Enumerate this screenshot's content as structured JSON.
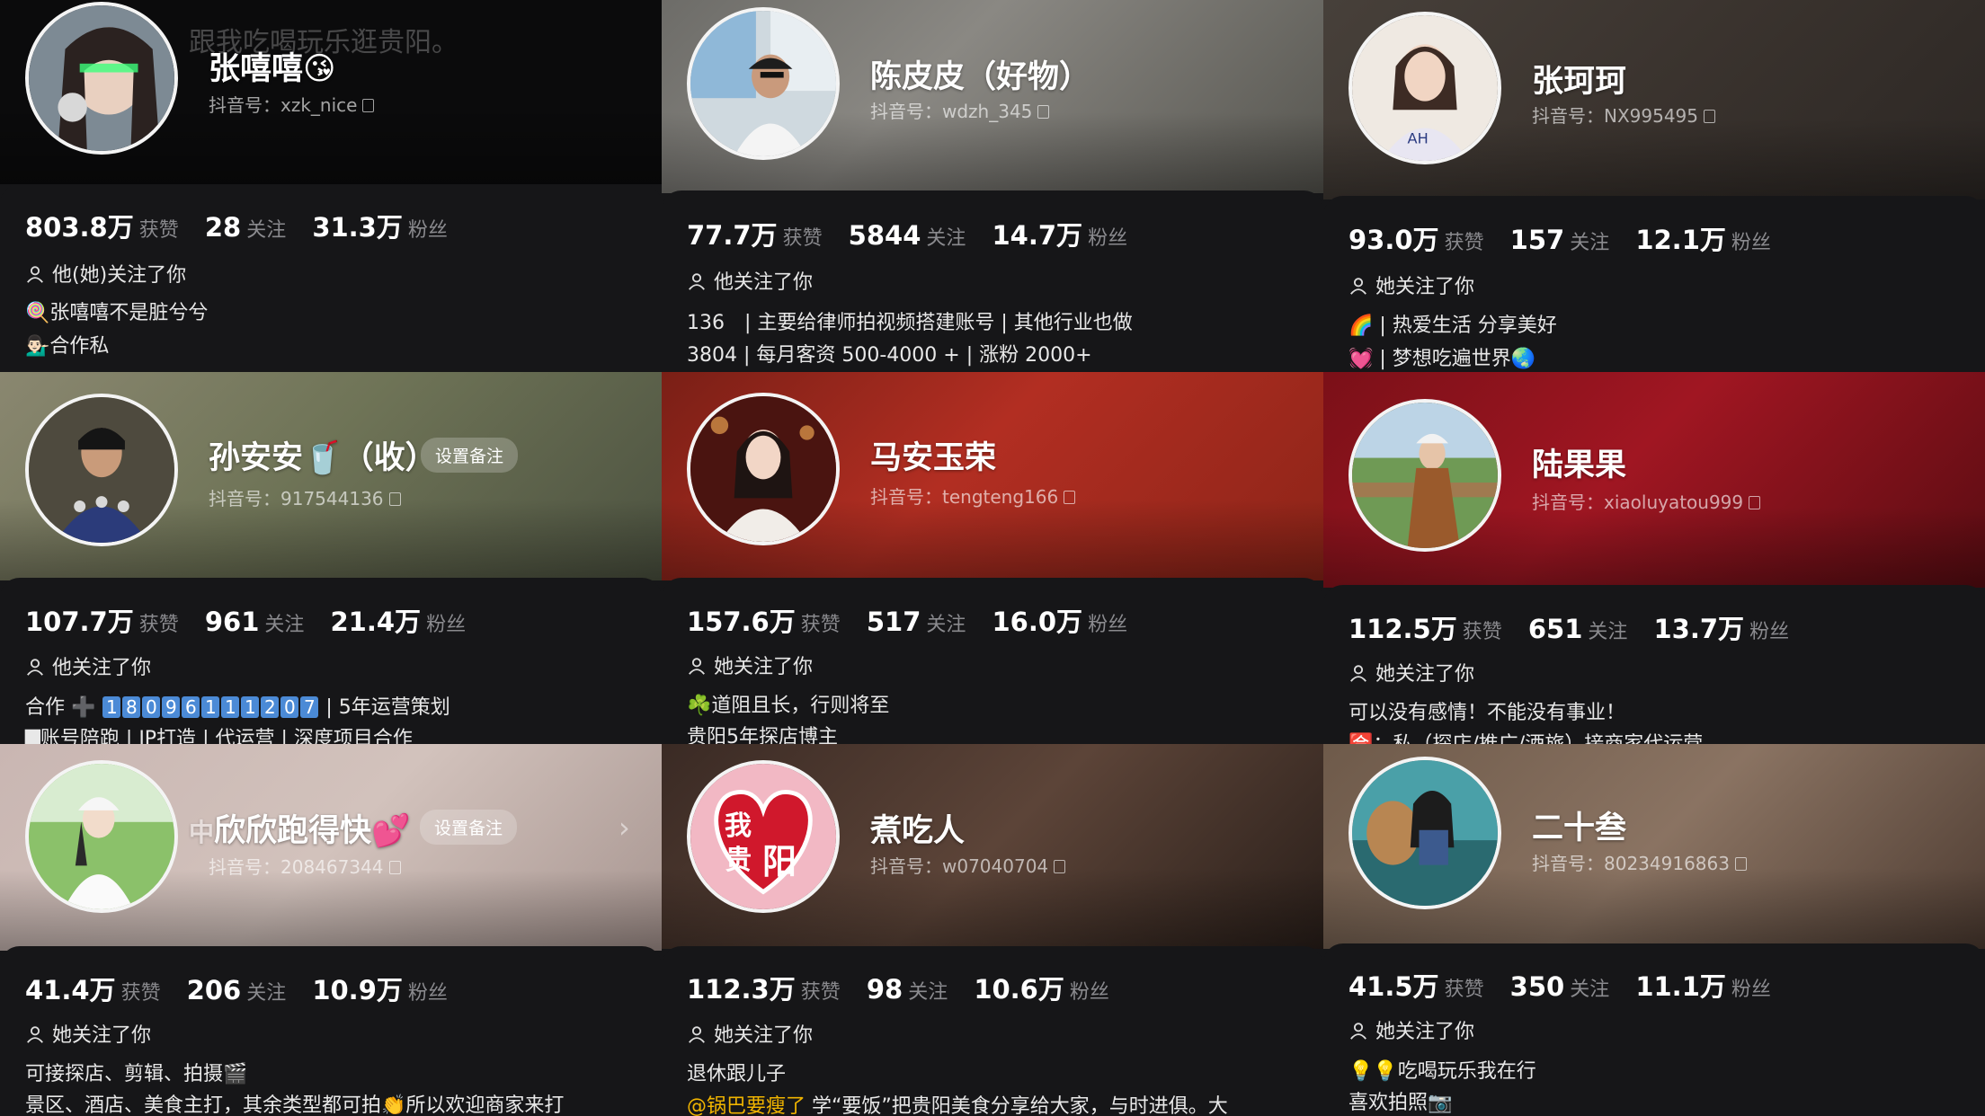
{
  "labels": {
    "likes": "获赞",
    "following": "关注",
    "followers": "粉丝",
    "set_remark": "设置备注"
  },
  "profiles": [
    {
      "name": "张嘻嘻",
      "name_emoji": "😘",
      "handle": "抖音号：xzk_nice",
      "overlay_text": "跟我吃喝玩乐逛贵阳。",
      "likes": "803.8万",
      "following": "28",
      "followers": "31.3万",
      "follow_status": "他(她)关注了你",
      "bio": [
        "🍭张嘻嘻不是脏兮兮",
        "💁🏻‍♂️合作私"
      ]
    },
    {
      "name": "陈皮皮（好物）",
      "handle": "抖音号：wdzh_345",
      "likes": "77.7万",
      "following": "5844",
      "followers": "14.7万",
      "follow_status": "他关注了你",
      "bio": [
        "136　| 主要给律师拍视频搭建账号 | 其他行业也做",
        "3804 | 每月客资 500-4000 + | 涨粉 2000+"
      ]
    },
    {
      "name": "张珂珂",
      "handle": "抖音号：NX995495",
      "likes": "93.0万",
      "following": "157",
      "followers": "12.1万",
      "follow_status": "她关注了你",
      "bio": [
        "🌈 | 热爱生活 分享美好",
        "💓 | 梦想吃遍世界🌏"
      ]
    },
    {
      "name": "孙安安",
      "name_emoji": "🥤",
      "name_suffix": "（收）",
      "handle": "抖音号：917544136",
      "likes": "107.7万",
      "following": "961",
      "followers": "21.4万",
      "follow_status": "他关注了你",
      "bio_prefix": "合作 ➕",
      "bio_digits": "18096111207",
      "bio_suffix": "| 5年运营策划",
      "bio": [
        "▇账号陪跑 | IP打造 | 代运营 | 深度项目合作"
      ]
    },
    {
      "name": "马安玉荣",
      "handle": "抖音号：tengteng166",
      "likes": "157.6万",
      "following": "517",
      "followers": "16.0万",
      "follow_status": "她关注了你",
      "bio": [
        "☘️道阻且长，行则将至",
        "贵阳5年探店博主"
      ]
    },
    {
      "name": "陆果果",
      "handle": "抖音号：xiaoluyatou999",
      "likes": "112.5万",
      "following": "651",
      "followers": "13.7万",
      "follow_status": "她关注了你",
      "bio": [
        "可以没有感情！不能没有事业！",
        "🈴：私（探店/推广/酒旅）接商家代运营"
      ]
    },
    {
      "name": "欣欣跑得快",
      "name_prefix": "中",
      "name_emoji": "💕",
      "handle": "抖音号：208467344",
      "likes": "41.4万",
      "following": "206",
      "followers": "10.9万",
      "follow_status": "她关注了你",
      "bio": [
        "可接探店、剪辑、拍摄🎬",
        "景区、酒店、美食主打，其余类型都可拍👏所以欢迎商家来打"
      ]
    },
    {
      "name": "煮吃人",
      "handle": "抖音号：w07040704",
      "avatar_text": [
        "我",
        "贵",
        "阳"
      ],
      "likes": "112.3万",
      "following": "98",
      "followers": "10.6万",
      "follow_status": "她关注了你",
      "bio": [
        "退休跟儿子"
      ],
      "bio_link": "@锅巴要瘦了",
      "bio_after_link": " 学“要饭”把贵阳美食分享给大家，与时进俱。大"
    },
    {
      "name": "二十叁",
      "handle": "抖音号：80234916863",
      "likes": "41.5万",
      "following": "350",
      "followers": "11.1万",
      "follow_status": "她关注了你",
      "bio": [
        "💡💡吃喝玩乐我在行",
        "喜欢拍照📷"
      ]
    }
  ],
  "colors": {
    "panel": "#161618",
    "muted": "#8a8a8e",
    "link": "#f0b400"
  }
}
